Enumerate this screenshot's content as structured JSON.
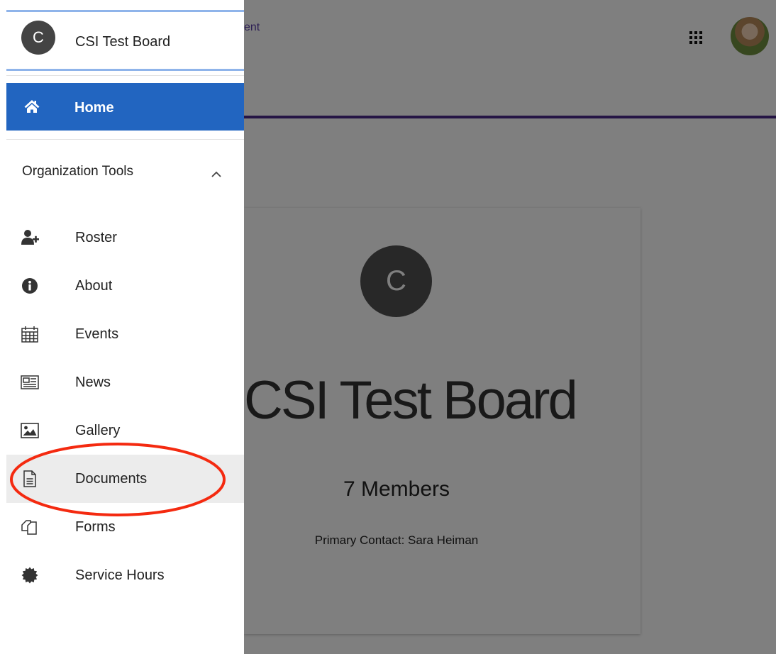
{
  "header": {
    "breadcrumb_fragment": "ent"
  },
  "drawer": {
    "org_initial": "C",
    "org_name": "CSI Test Board",
    "home_label": "Home",
    "section_title": "Organization Tools",
    "items": [
      {
        "label": "Roster",
        "icon": "user-add-icon"
      },
      {
        "label": "About",
        "icon": "info-icon"
      },
      {
        "label": "Events",
        "icon": "calendar-icon"
      },
      {
        "label": "News",
        "icon": "newspaper-icon"
      },
      {
        "label": "Gallery",
        "icon": "image-icon"
      },
      {
        "label": "Documents",
        "icon": "document-icon",
        "selected": true
      },
      {
        "label": "Forms",
        "icon": "forms-icon"
      },
      {
        "label": "Service Hours",
        "icon": "badge-icon"
      }
    ]
  },
  "card": {
    "initial": "C",
    "title": "CSI Test Board",
    "members": "7 Members",
    "contact": "Primary Contact: Sara Heiman"
  },
  "colors": {
    "accent_blue": "#2265c0",
    "annotation_red": "#f42a10",
    "header_accent": "#4a2a8a"
  }
}
